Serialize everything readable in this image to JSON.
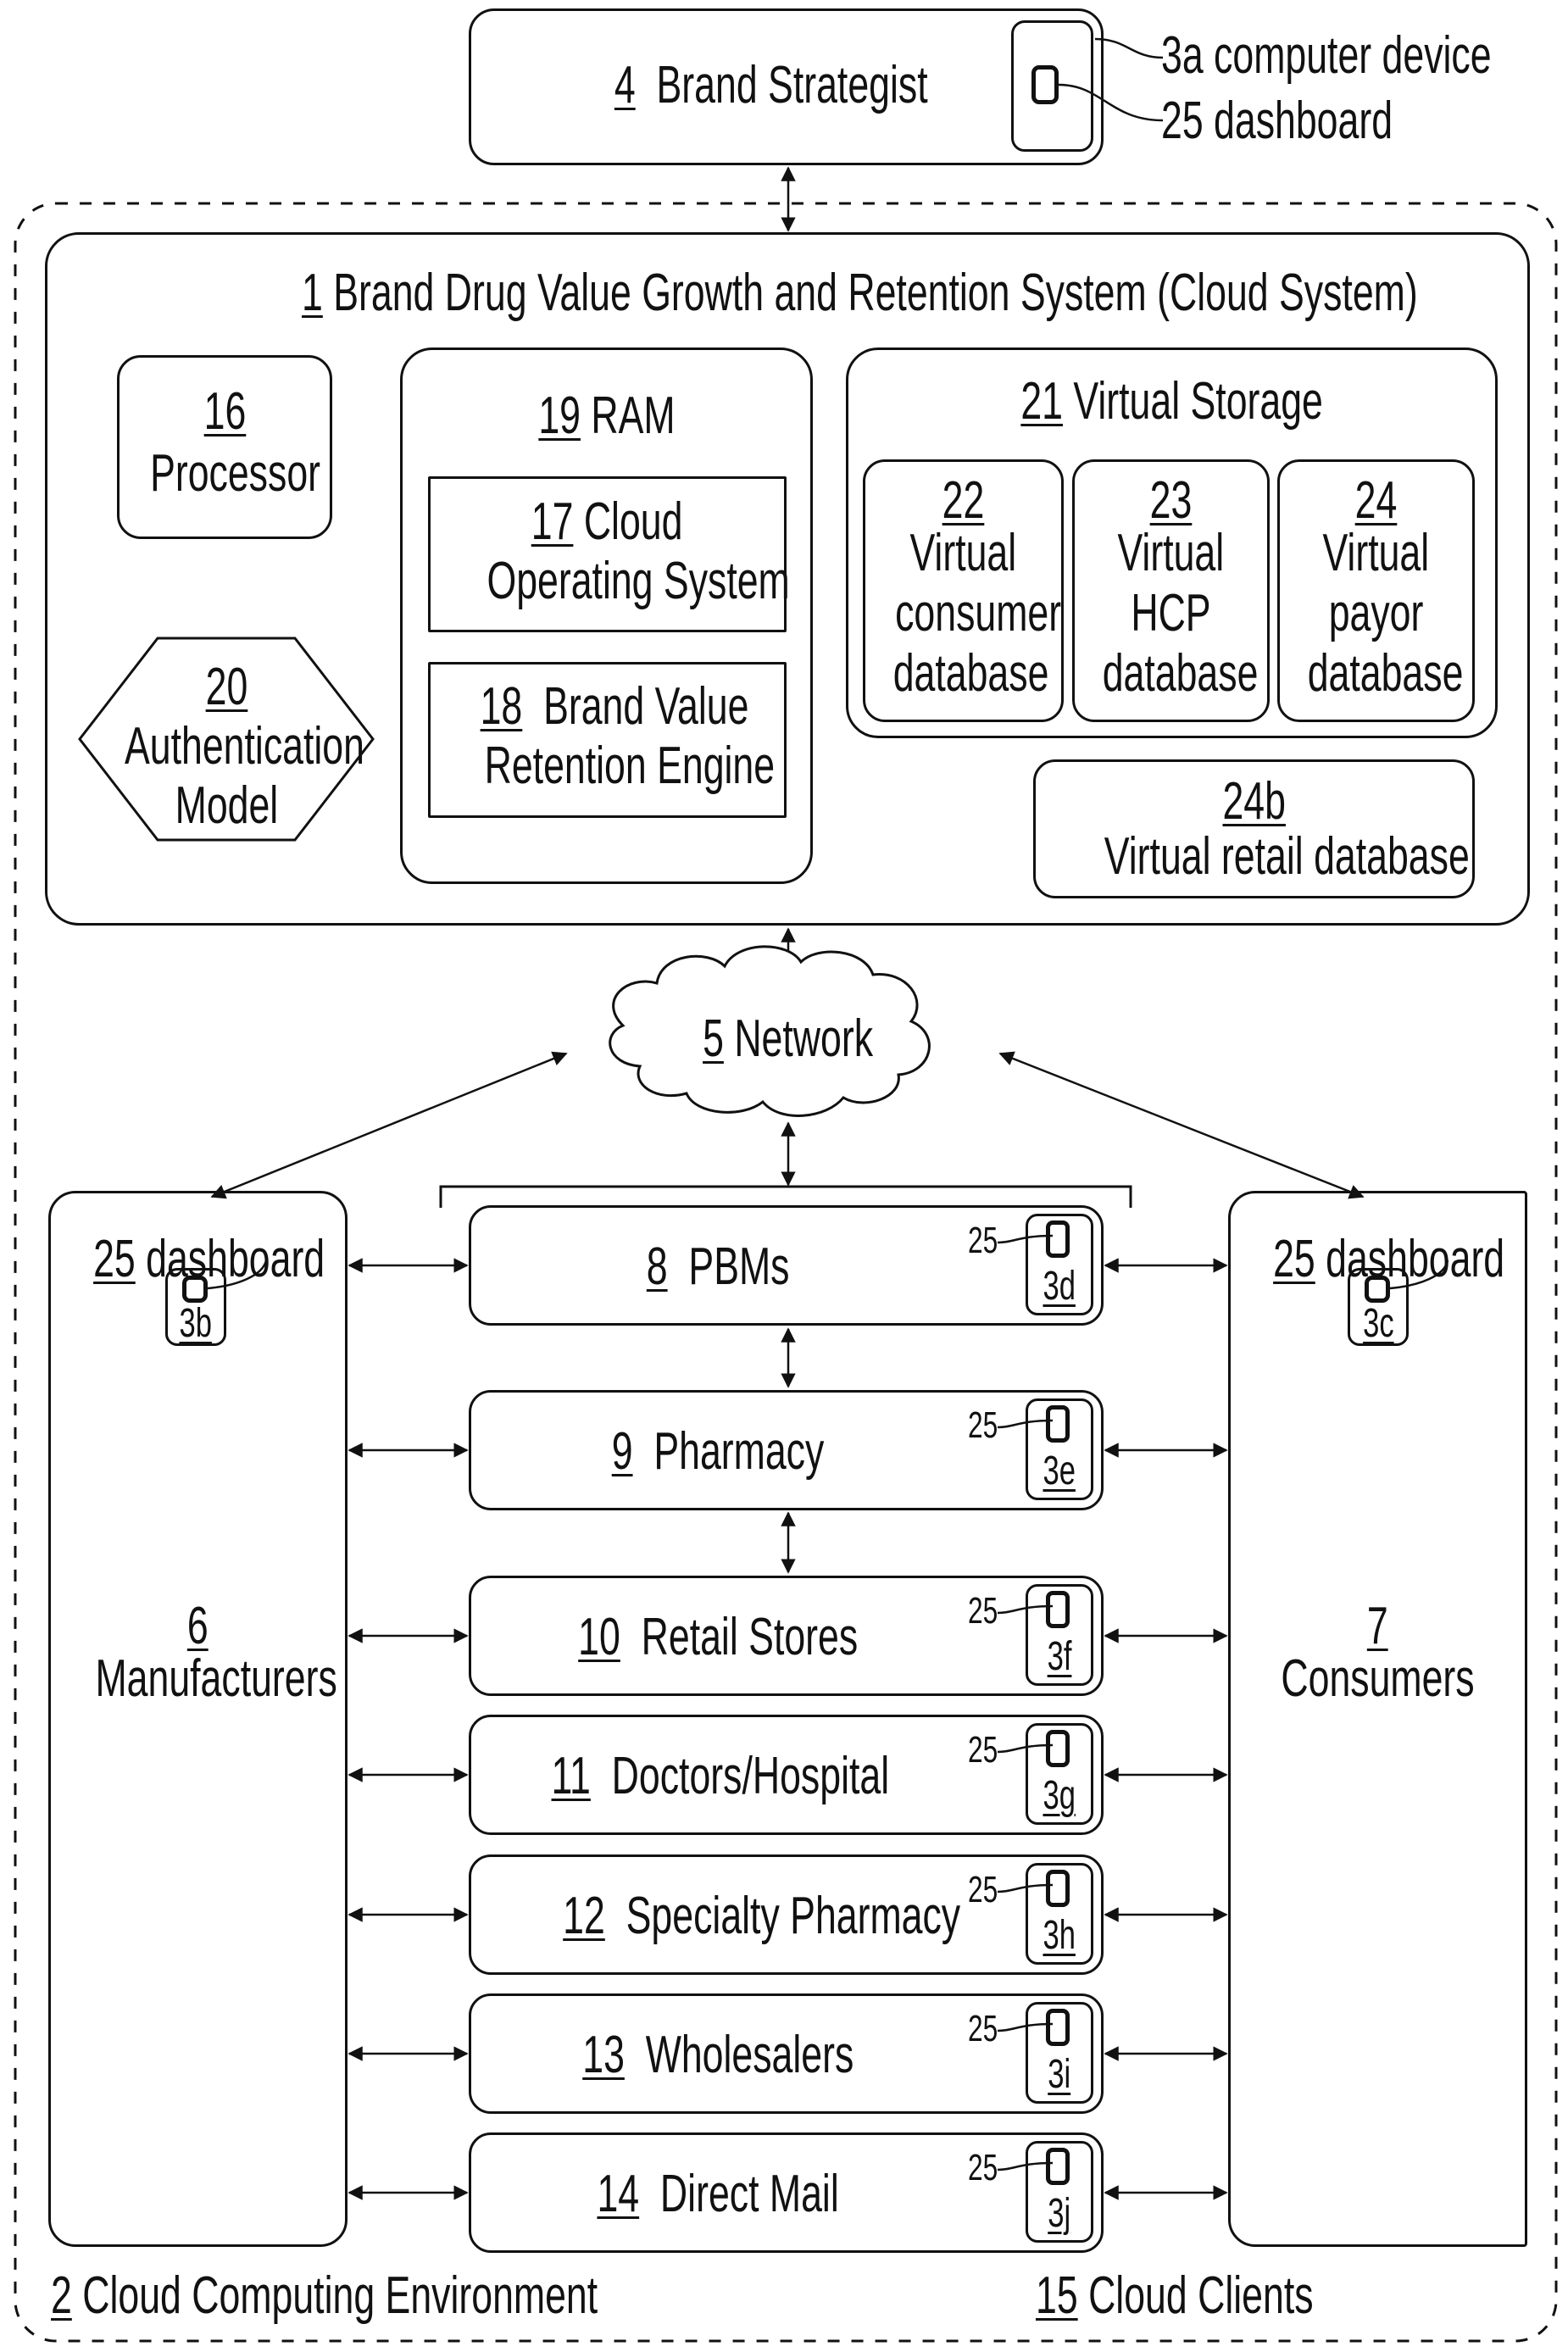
{
  "brand_strategist": {
    "ref": "4",
    "label": "Brand Strategist",
    "device_callout": "3a computer device",
    "dashboard_callout": "25 dashboard"
  },
  "system": {
    "ref": "1",
    "title": "Brand Drug Value Growth and Retention System (Cloud System)",
    "processor": {
      "ref": "16",
      "label": "Processor"
    },
    "auth": {
      "ref": "20",
      "line1": "Authentication",
      "line2": "Model"
    },
    "ram": {
      "ref": "19",
      "label": "RAM",
      "os": {
        "ref": "17",
        "line1": "Cloud",
        "line2": "Operating System"
      },
      "engine": {
        "ref": "18",
        "line1": "Brand Value",
        "line2": "Retention Engine"
      }
    },
    "storage": {
      "ref": "21",
      "label": "Virtual Storage",
      "databases": [
        {
          "ref": "22",
          "line1": "Virtual",
          "line2": "consumer",
          "line3": "database"
        },
        {
          "ref": "23",
          "line1": "Virtual",
          "line2": "HCP",
          "line3": "database"
        },
        {
          "ref": "24",
          "line1": "Virtual",
          "line2": "payor",
          "line3": "database"
        }
      ]
    },
    "retail_db": {
      "ref": "24b",
      "label": "Virtual retail database"
    }
  },
  "network": {
    "ref": "5",
    "label": "Network"
  },
  "manufacturers": {
    "ref": "6",
    "label": "Manufacturers",
    "dash_ref": "25",
    "dash_label": "dashboard",
    "device": "3b"
  },
  "consumers": {
    "ref": "7",
    "label": "Consumers",
    "dash_ref": "25",
    "dash_label": "dashboard",
    "device": "3c"
  },
  "entities": [
    {
      "ref": "8",
      "label": "PBMs",
      "dash_ref": "25",
      "device": "3d"
    },
    {
      "ref": "9",
      "label": "Pharmacy",
      "dash_ref": "25",
      "device": "3e"
    },
    {
      "ref": "10",
      "label": "Retail Stores",
      "dash_ref": "25",
      "device": "3f"
    },
    {
      "ref": "11",
      "label": "Doctors/Hospital",
      "dash_ref": "25",
      "device": "3g"
    },
    {
      "ref": "12",
      "label": "Specialty Pharmacy",
      "dash_ref": "25",
      "device": "3h"
    },
    {
      "ref": "13",
      "label": "Wholesalers",
      "dash_ref": "25",
      "device": "3i"
    },
    {
      "ref": "14",
      "label": "Direct Mail",
      "dash_ref": "25",
      "device": "3j"
    }
  ],
  "environment": {
    "ref": "2",
    "label": "Cloud Computing Environment"
  },
  "cloud_clients": {
    "ref": "15",
    "label": "Cloud Clients"
  }
}
